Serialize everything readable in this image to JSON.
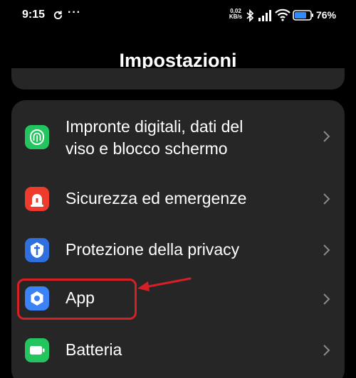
{
  "status_bar": {
    "time": "9:15",
    "overflow_dots": "···",
    "net_speed_value": "0,02",
    "net_speed_unit": "KB/s",
    "battery_percent": "76%",
    "battery_level": 0.76,
    "icons": [
      "sync-icon",
      "bluetooth-icon",
      "signal-icon",
      "wifi-icon",
      "battery-icon"
    ]
  },
  "header": {
    "title": "Impostazioni"
  },
  "settings_list": {
    "items": [
      {
        "label_line1": "Impronte digitali, dati del",
        "label_line2": "viso e blocco schermo",
        "icon": "fingerprint-icon",
        "icon_color": "#22c55e"
      },
      {
        "label": "Sicurezza ed emergenze",
        "icon": "emergency-icon",
        "icon_color": "#ef3b2c"
      },
      {
        "label": "Protezione della privacy",
        "icon": "privacy-icon",
        "icon_color": "#2f6fe0"
      },
      {
        "label": "App",
        "icon": "app-settings-icon",
        "icon_color": "#3b82f6"
      },
      {
        "label": "Batteria",
        "icon": "battery-settings-icon",
        "icon_color": "#22c55e"
      }
    ]
  },
  "colors": {
    "background": "#000000",
    "card": "#262626",
    "chevron": "#8a8a8a",
    "annotation": "#d71f26"
  }
}
